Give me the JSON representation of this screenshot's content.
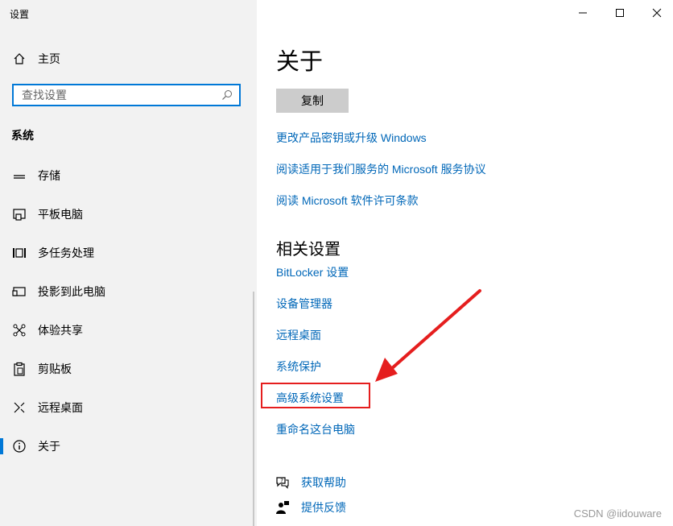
{
  "window": {
    "title": "设置"
  },
  "sidebar": {
    "home_label": "主页",
    "search_placeholder": "查找设置",
    "section": "系统",
    "items": [
      {
        "label": "存储",
        "icon": "storage-icon"
      },
      {
        "label": "平板电脑",
        "icon": "tablet-icon"
      },
      {
        "label": "多任务处理",
        "icon": "multitasking-icon"
      },
      {
        "label": "投影到此电脑",
        "icon": "projecting-icon"
      },
      {
        "label": "体验共享",
        "icon": "shared-experiences-icon"
      },
      {
        "label": "剪贴板",
        "icon": "clipboard-icon"
      },
      {
        "label": "远程桌面",
        "icon": "remote-desktop-icon"
      },
      {
        "label": "关于",
        "icon": "info-icon"
      }
    ]
  },
  "main": {
    "title": "关于",
    "copy_button": "复制",
    "links": [
      "更改产品密钥或升级 Windows",
      "阅读适用于我们服务的 Microsoft 服务协议",
      "阅读 Microsoft 软件许可条款"
    ],
    "related_title": "相关设置",
    "related_links": [
      "BitLocker 设置",
      "设备管理器",
      "远程桌面",
      "系统保护",
      "高级系统设置",
      "重命名这台电脑"
    ],
    "help": [
      {
        "label": "获取帮助",
        "icon": "help-icon"
      },
      {
        "label": "提供反馈",
        "icon": "feedback-icon"
      }
    ]
  },
  "watermark": "CSDN @iidouware",
  "colors": {
    "accent": "#0078d7",
    "link": "#0067b8",
    "annotation": "#e51e1e"
  }
}
